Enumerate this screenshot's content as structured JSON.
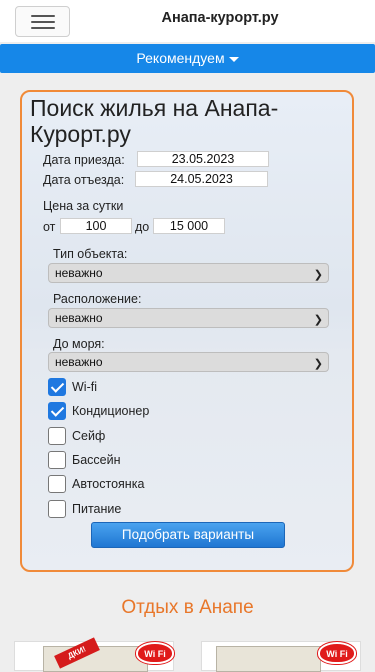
{
  "header": {
    "title": "Анапа-курорт.ру"
  },
  "recommend": {
    "label": "Рекомендуем"
  },
  "search": {
    "title": "Поиск жилья на Анапа-Курорт.ру",
    "arrival_label": "Дата приезда:",
    "arrival_value": "23.05.2023",
    "departure_label": "Дата отъезда:",
    "departure_value": "24.05.2023",
    "price_label": "Цена за сутки",
    "price_from_label": "от",
    "price_from_value": "100",
    "price_to_label": "до",
    "price_to_value": "15 000",
    "type_label": "Тип объекта:",
    "type_value": "неважно",
    "location_label": "Расположение:",
    "location_value": "неважно",
    "sea_label": "До моря:",
    "sea_value": "неважно",
    "amenities": [
      {
        "label": "Wi-fi",
        "checked": true
      },
      {
        "label": "Кондиционер",
        "checked": true
      },
      {
        "label": "Сейф",
        "checked": false
      },
      {
        "label": "Бассейн",
        "checked": false
      },
      {
        "label": "Автостоянка",
        "checked": false
      },
      {
        "label": "Питание",
        "checked": false
      }
    ],
    "submit_label": "Подобрать варианты"
  },
  "section": {
    "title": "Отдых в Анапе"
  },
  "cards": [
    {
      "badge": "Wi Fi",
      "ribbon": "ДКИ!"
    },
    {
      "badge": "Wi Fi"
    }
  ],
  "colors": {
    "accent": "#1687e8",
    "frame": "#f08a39",
    "section_title": "#e8772a"
  }
}
